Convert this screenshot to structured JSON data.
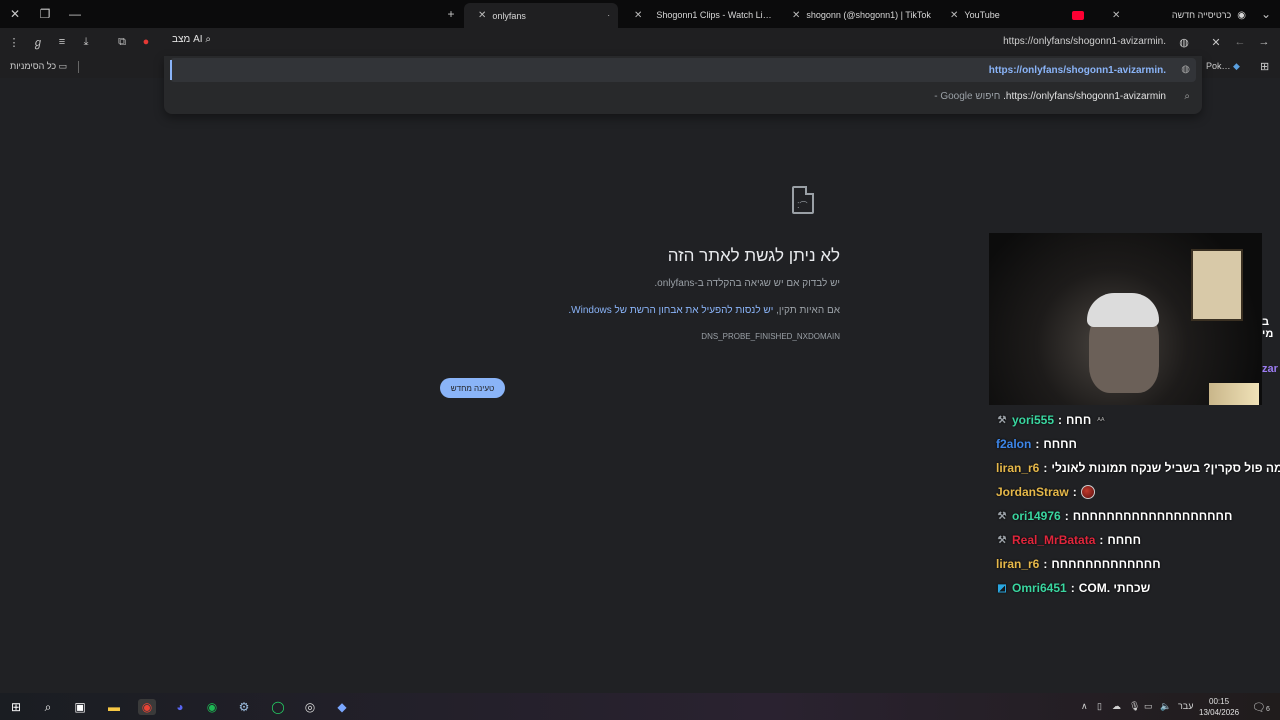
{
  "tabs": [
    {
      "title": "onlyfans",
      "active": true
    },
    {
      "title": "Shogonn1 Clips - Watch Li…",
      "active": false
    },
    {
      "title": "shogonn (@shogonn1) | TikTok",
      "active": false
    },
    {
      "title": "YouTube",
      "active": false
    },
    {
      "title": "כרטיסייה חדשה",
      "active": false
    }
  ],
  "toolbar": {
    "ai_mode_label": "מצב AI",
    "omnibox_url": "https://onlyfans/shogonn1-avizarmin."
  },
  "bookmarks": {
    "all_bookmarks_label": "כל הסימניות",
    "overflow_label": "Pok…"
  },
  "dropdown": {
    "suggestion1": "https://onlyfans/shogonn1-avizarmin.",
    "suggestion2_query": "https://onlyfans/shogonn1-avizarmin.",
    "suggestion2_suffix": "חיפוש Google -"
  },
  "error": {
    "title": "לא ניתן לגשת לאתר הזה",
    "line1": "יש לבדוק אם יש שגיאה בהקלדה ב-onlyfans.",
    "line2_prefix": "אם האיות תקין,",
    "line2_link": "יש לנסות להפעיל את אבחון הרשת של Windows.",
    "code": "DNS_PROBE_FINISHED_NXDOMAIN",
    "reload_label": "טעינה מחדש"
  },
  "chat_edge": {
    "line1": "ב מי",
    "line2": "zar"
  },
  "chat": [
    {
      "user": "yori555",
      "color": "#3ad6a0",
      "badge": true,
      "text": "חחח",
      "emote": false
    },
    {
      "user": "f2alon",
      "color": "#3d86e8",
      "badge": false,
      "text": "חחחח",
      "emote": false
    },
    {
      "user": "liran_r6",
      "color": "#e6b84a",
      "badge": false,
      "text": "למה פול סקרין? בשביל שנקח תמונות לאונלי",
      "emote": false
    },
    {
      "user": "JordanStraw",
      "color": "#e6b84a",
      "badge": false,
      "text": "",
      "emote": true
    },
    {
      "user": "ori14976",
      "color": "#3ad6a0",
      "badge": true,
      "text": "חחחחחחחחחחחחחחחחחחח",
      "emote": false
    },
    {
      "user": "Real_MrBatata",
      "color": "#e0263c",
      "badge": true,
      "text": "חחחח",
      "emote": false
    },
    {
      "user": "liran_r6",
      "color": "#e6b84a",
      "badge": false,
      "text": "חחחחחחחחחחחחח",
      "emote": false
    },
    {
      "user": "Omri6451",
      "color": "#3ad6a0",
      "badge": true,
      "text": "שכחתי .COM",
      "emote": false
    }
  ],
  "taskbar": {
    "language": "עבר",
    "time": "00:15",
    "date": "13/04/2026",
    "notifications": "6"
  }
}
